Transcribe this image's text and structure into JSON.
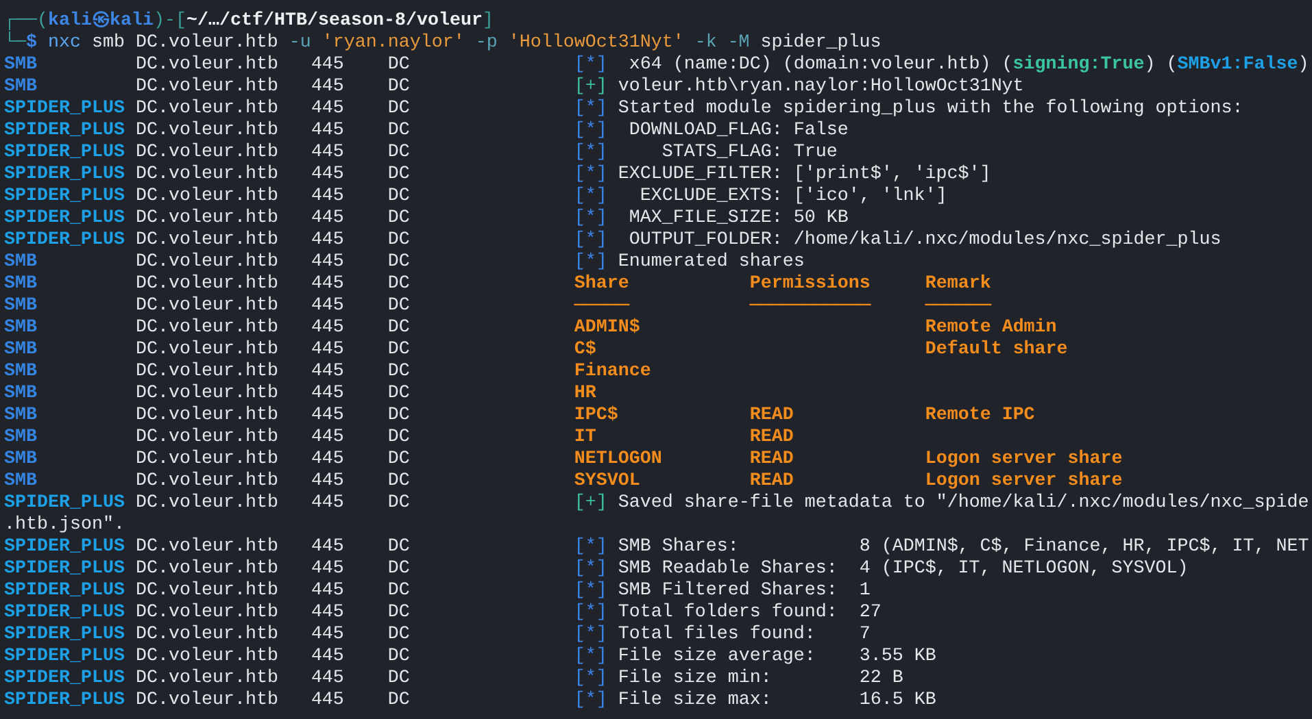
{
  "prompt": {
    "frame_open": "┌──(",
    "user": "kali",
    "at": "㉿",
    "host": "kali",
    "frame_mid": ")-[",
    "path": "~/…/ctf/HTB/season-8/voleur",
    "frame_close": "]",
    "corner": "└─",
    "symbol": "$"
  },
  "command": [
    {
      "text": "nxc",
      "kind": "program"
    },
    {
      "text": "smb",
      "kind": "arg"
    },
    {
      "text": "DC.voleur.htb",
      "kind": "arg"
    },
    {
      "text": "-u",
      "kind": "flag"
    },
    {
      "text": "'ryan.naylor'",
      "kind": "string"
    },
    {
      "text": "-p",
      "kind": "flag"
    },
    {
      "text": "'HollowOct31Nyt'",
      "kind": "string"
    },
    {
      "text": "-k",
      "kind": "flag"
    },
    {
      "text": "-M",
      "kind": "flag"
    },
    {
      "text": "spider_plus",
      "kind": "arg"
    }
  ],
  "lines": [
    {
      "kind": "info",
      "module": "SMB",
      "color": "#3485e3",
      "host": "DC.voleur.htb",
      "port": "445",
      "name": "DC",
      "marker": {
        "text": "[*]",
        "kind": "info"
      },
      "segments": [
        {
          "text": "x64 (name:DC) (domain:voleur.htb) (",
          "kind": "plain"
        },
        {
          "text": "signing:True",
          "kind": "green"
        },
        {
          "text": ") (",
          "kind": "plain"
        },
        {
          "text": "SMBv1:False",
          "kind": "blue"
        },
        {
          "text": ")",
          "kind": "plain"
        }
      ]
    },
    {
      "kind": "log",
      "module": "SMB",
      "color": "#3485e3",
      "host": "DC.voleur.htb",
      "port": "445",
      "name": "DC",
      "marker": {
        "text": "[+]",
        "kind": "success"
      },
      "message": "voleur.htb\\ryan.naylor:HollowOct31Nyt"
    },
    {
      "kind": "log",
      "module": "SPIDER_PLUS",
      "color": "#1ea0e6",
      "host": "DC.voleur.htb",
      "port": "445",
      "name": "DC",
      "marker": {
        "text": "[*]",
        "kind": "info"
      },
      "message": "Started module spidering_plus with the following options:"
    },
    {
      "kind": "option",
      "module": "SPIDER_PLUS",
      "color": "#1ea0e6",
      "host": "DC.voleur.htb",
      "port": "445",
      "name": "DC",
      "marker": {
        "text": "[*]",
        "kind": "info"
      },
      "key": "DOWNLOAD_FLAG:",
      "value": "False"
    },
    {
      "kind": "option",
      "module": "SPIDER_PLUS",
      "color": "#1ea0e6",
      "host": "DC.voleur.htb",
      "port": "445",
      "name": "DC",
      "marker": {
        "text": "[*]",
        "kind": "info"
      },
      "key": "STATS_FLAG:",
      "value": "True"
    },
    {
      "kind": "option",
      "module": "SPIDER_PLUS",
      "color": "#1ea0e6",
      "host": "DC.voleur.htb",
      "port": "445",
      "name": "DC",
      "marker": {
        "text": "[*]",
        "kind": "info"
      },
      "key": "EXCLUDE_FILTER:",
      "value": "['print$', 'ipc$']"
    },
    {
      "kind": "option",
      "module": "SPIDER_PLUS",
      "color": "#1ea0e6",
      "host": "DC.voleur.htb",
      "port": "445",
      "name": "DC",
      "marker": {
        "text": "[*]",
        "kind": "info"
      },
      "key": "EXCLUDE_EXTS:",
      "value": "['ico', 'lnk']"
    },
    {
      "kind": "option",
      "module": "SPIDER_PLUS",
      "color": "#1ea0e6",
      "host": "DC.voleur.htb",
      "port": "445",
      "name": "DC",
      "marker": {
        "text": "[*]",
        "kind": "info"
      },
      "key": "MAX_FILE_SIZE:",
      "value": "50 KB"
    },
    {
      "kind": "option",
      "module": "SPIDER_PLUS",
      "color": "#1ea0e6",
      "host": "DC.voleur.htb",
      "port": "445",
      "name": "DC",
      "marker": {
        "text": "[*]",
        "kind": "info"
      },
      "key": "OUTPUT_FOLDER:",
      "value": "/home/kali/.nxc/modules/nxc_spider_plus"
    },
    {
      "kind": "log",
      "module": "SMB",
      "color": "#3485e3",
      "host": "DC.voleur.htb",
      "port": "445",
      "name": "DC",
      "marker": {
        "text": "[*]",
        "kind": "info"
      },
      "message": "Enumerated shares"
    },
    {
      "kind": "header",
      "module": "SMB",
      "color": "#3485e3",
      "host": "DC.voleur.htb",
      "port": "445",
      "name": "DC",
      "share": "Share",
      "permissions": "Permissions",
      "remark": "Remark"
    },
    {
      "kind": "rule",
      "module": "SMB",
      "color": "#3485e3",
      "host": "DC.voleur.htb",
      "port": "445",
      "name": "DC",
      "share": "─────",
      "permissions": "───────────",
      "remark": "──────"
    },
    {
      "kind": "share",
      "module": "SMB",
      "color": "#3485e3",
      "host": "DC.voleur.htb",
      "port": "445",
      "name": "DC",
      "share": "ADMIN$",
      "remark": "Remote Admin"
    },
    {
      "kind": "share",
      "module": "SMB",
      "color": "#3485e3",
      "host": "DC.voleur.htb",
      "port": "445",
      "name": "DC",
      "share": "C$",
      "remark": "Default share"
    },
    {
      "kind": "share",
      "module": "SMB",
      "color": "#3485e3",
      "host": "DC.voleur.htb",
      "port": "445",
      "name": "DC",
      "share": "Finance"
    },
    {
      "kind": "share",
      "module": "SMB",
      "color": "#3485e3",
      "host": "DC.voleur.htb",
      "port": "445",
      "name": "DC",
      "share": "HR"
    },
    {
      "kind": "share",
      "module": "SMB",
      "color": "#3485e3",
      "host": "DC.voleur.htb",
      "port": "445",
      "name": "DC",
      "share": "IPC$",
      "permissions": "READ",
      "remark": "Remote IPC"
    },
    {
      "kind": "share",
      "module": "SMB",
      "color": "#3485e3",
      "host": "DC.voleur.htb",
      "port": "445",
      "name": "DC",
      "share": "IT",
      "permissions": "READ"
    },
    {
      "kind": "share",
      "module": "SMB",
      "color": "#3485e3",
      "host": "DC.voleur.htb",
      "port": "445",
      "name": "DC",
      "share": "NETLOGON",
      "permissions": "READ",
      "remark": "Logon server share"
    },
    {
      "kind": "share",
      "module": "SMB",
      "color": "#3485e3",
      "host": "DC.voleur.htb",
      "port": "445",
      "name": "DC",
      "share": "SYSVOL",
      "permissions": "READ",
      "remark": "Logon server share"
    },
    {
      "kind": "log",
      "module": "SPIDER_PLUS",
      "color": "#1ea0e6",
      "host": "DC.voleur.htb",
      "port": "445",
      "name": "DC",
      "marker": {
        "text": "[+]",
        "kind": "success"
      },
      "message": "Saved share-file metadata to \"/home/kali/.nxc/modules/nxc_spide"
    },
    {
      "kind": "continuation",
      "text": ".htb.json\"."
    },
    {
      "kind": "stat",
      "module": "SPIDER_PLUS",
      "color": "#1ea0e6",
      "host": "DC.voleur.htb",
      "port": "445",
      "name": "DC",
      "marker": {
        "text": "[*]",
        "kind": "info"
      },
      "label": "SMB Shares:",
      "value": "8 (ADMIN$, C$, Finance, HR, IPC$, IT, NET"
    },
    {
      "kind": "stat",
      "module": "SPIDER_PLUS",
      "color": "#1ea0e6",
      "host": "DC.voleur.htb",
      "port": "445",
      "name": "DC",
      "marker": {
        "text": "[*]",
        "kind": "info"
      },
      "label": "SMB Readable Shares:",
      "value": "4 (IPC$, IT, NETLOGON, SYSVOL)"
    },
    {
      "kind": "stat",
      "module": "SPIDER_PLUS",
      "color": "#1ea0e6",
      "host": "DC.voleur.htb",
      "port": "445",
      "name": "DC",
      "marker": {
        "text": "[*]",
        "kind": "info"
      },
      "label": "SMB Filtered Shares:",
      "value": "1"
    },
    {
      "kind": "stat",
      "module": "SPIDER_PLUS",
      "color": "#1ea0e6",
      "host": "DC.voleur.htb",
      "port": "445",
      "name": "DC",
      "marker": {
        "text": "[*]",
        "kind": "info"
      },
      "label": "Total folders found:",
      "value": "27"
    },
    {
      "kind": "stat",
      "module": "SPIDER_PLUS",
      "color": "#1ea0e6",
      "host": "DC.voleur.htb",
      "port": "445",
      "name": "DC",
      "marker": {
        "text": "[*]",
        "kind": "info"
      },
      "label": "Total files found:",
      "value": "7"
    },
    {
      "kind": "stat",
      "module": "SPIDER_PLUS",
      "color": "#1ea0e6",
      "host": "DC.voleur.htb",
      "port": "445",
      "name": "DC",
      "marker": {
        "text": "[*]",
        "kind": "info"
      },
      "label": "File size average:",
      "value": "3.55 KB"
    },
    {
      "kind": "stat",
      "module": "SPIDER_PLUS",
      "color": "#1ea0e6",
      "host": "DC.voleur.htb",
      "port": "445",
      "name": "DC",
      "marker": {
        "text": "[*]",
        "kind": "info"
      },
      "label": "File size min:",
      "value": "22 B"
    },
    {
      "kind": "stat",
      "module": "SPIDER_PLUS",
      "color": "#1ea0e6",
      "host": "DC.voleur.htb",
      "port": "445",
      "name": "DC",
      "marker": {
        "text": "[*]",
        "kind": "info"
      },
      "label": "File size max:",
      "value": "16.5 KB"
    }
  ]
}
